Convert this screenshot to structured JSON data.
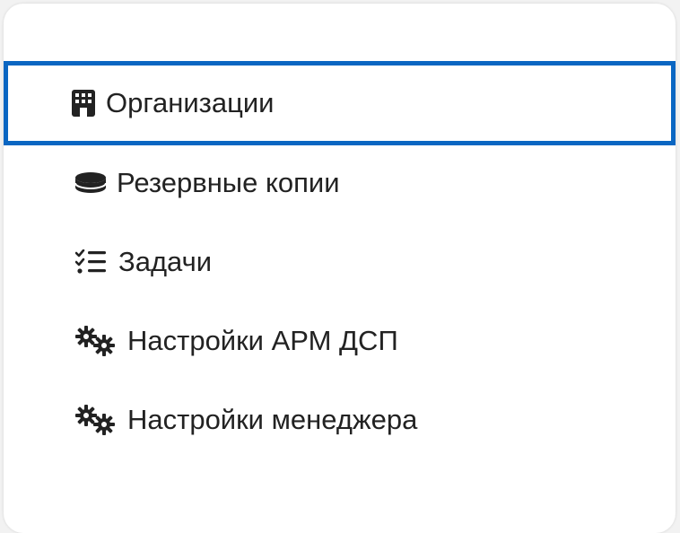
{
  "menu": {
    "items": [
      {
        "label": "Организации",
        "icon": "building-icon",
        "active": true
      },
      {
        "label": "Резервные копии",
        "icon": "database-icon",
        "active": false
      },
      {
        "label": "Задачи",
        "icon": "task-list-icon",
        "active": false
      },
      {
        "label": "Настройки АРМ ДСП",
        "icon": "gears-icon",
        "active": false
      },
      {
        "label": "Настройки менеджера",
        "icon": "gears-icon",
        "active": false
      }
    ]
  },
  "colors": {
    "active_border": "#0a66c2",
    "text": "#222222",
    "background": "#ffffff"
  }
}
